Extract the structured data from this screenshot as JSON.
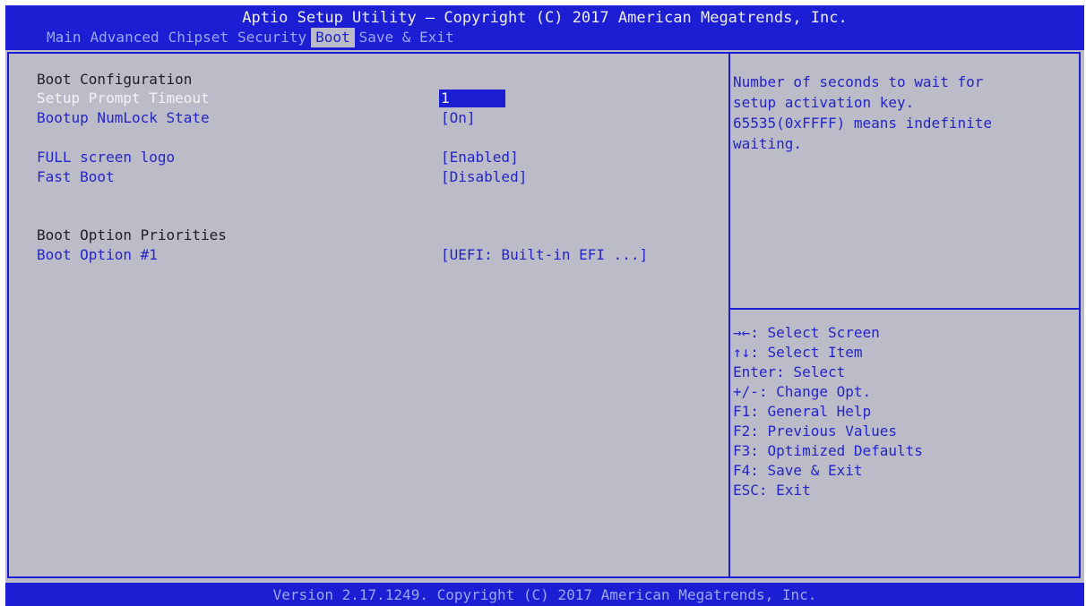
{
  "header": {
    "title": "Aptio Setup Utility – Copyright (C) 2017 American Megatrends, Inc.",
    "tabs": [
      {
        "label": "Main",
        "active": false
      },
      {
        "label": "Advanced",
        "active": false
      },
      {
        "label": "Chipset",
        "active": false
      },
      {
        "label": "Security",
        "active": false
      },
      {
        "label": "Boot",
        "active": true
      },
      {
        "label": "Save & Exit",
        "active": false
      }
    ]
  },
  "main": {
    "section_boot_configuration": "Boot Configuration",
    "items": [
      {
        "label": "Setup Prompt Timeout",
        "value": "1",
        "selected": true
      },
      {
        "label": "Bootup NumLock State",
        "value": "[On]"
      },
      {
        "label": "FULL screen logo",
        "value": "[Enabled]"
      },
      {
        "label": "Fast Boot",
        "value": "[Disabled]"
      },
      {
        "label": "Boot Option #1",
        "value": "[UEFI: Built-in EFI ...]"
      }
    ],
    "section_boot_option_priorities": "Boot Option Priorities"
  },
  "help": {
    "lines": [
      "Number of seconds to wait for",
      "setup activation key.",
      "65535(0xFFFF) means indefinite",
      "waiting."
    ]
  },
  "keys": [
    "→←: Select Screen",
    "↑↓: Select Item",
    "Enter: Select",
    "+/-: Change Opt.",
    "F1: General Help",
    "F2: Previous Values",
    "F3: Optimized Defaults",
    "F4: Save & Exit",
    "ESC: Exit"
  ],
  "footer": {
    "text": "Version 2.17.1249. Copyright (C) 2017 American Megatrends, Inc."
  },
  "colors": {
    "bios_blue": "#1c1ed4",
    "panel_gray": "#bcbcc8",
    "text_white": "#f2f2f2",
    "text_blue": "#2424c8",
    "tab_inactive": "#9da6ee"
  }
}
